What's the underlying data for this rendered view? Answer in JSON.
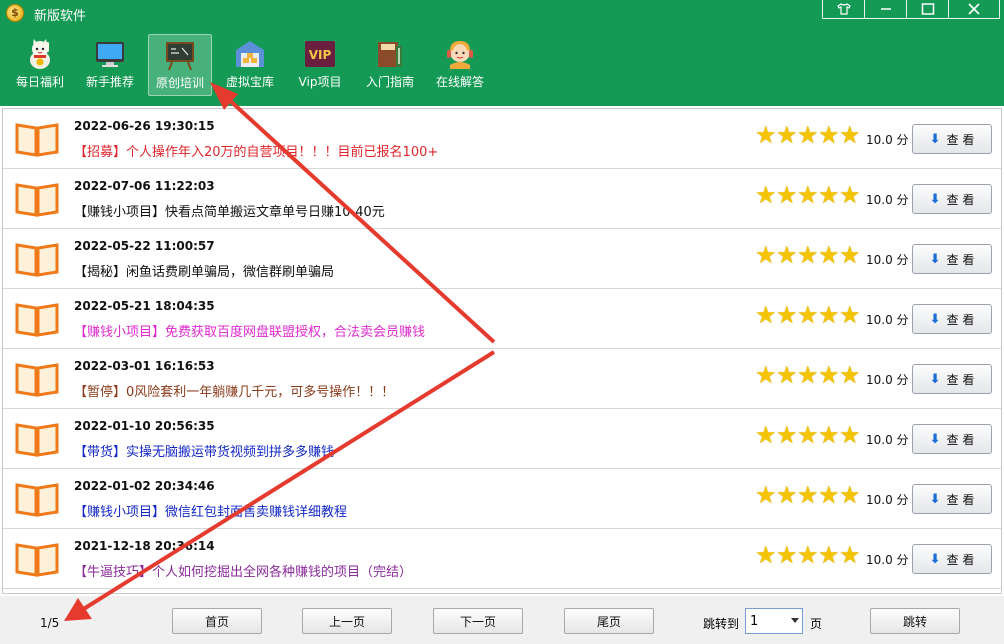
{
  "window": {
    "title": "新版软件",
    "logo_icon": "coin-icon",
    "controls": [
      "skin-icon",
      "minimize-icon",
      "maximize-icon",
      "close-icon"
    ]
  },
  "nav": {
    "items": [
      {
        "label": "每日福利",
        "icon": "lucky-cat-icon"
      },
      {
        "label": "新手推荐",
        "icon": "monitor-icon"
      },
      {
        "label": "原创培训",
        "icon": "blackboard-icon",
        "active": true
      },
      {
        "label": "虚拟宝库",
        "icon": "warehouse-icon"
      },
      {
        "label": "Vip项目",
        "icon": "vip-icon"
      },
      {
        "label": "入门指南",
        "icon": "books-icon"
      },
      {
        "label": "在线解答",
        "icon": "support-agent-icon"
      }
    ]
  },
  "list": {
    "view_label": "查 看",
    "items": [
      {
        "date": "2022-06-26 19:30:15",
        "title": "【招募】个人操作年入20万的自营项目！！！目前已报名100+",
        "color": "#e0262b",
        "rating": 5,
        "score": "10.0 分"
      },
      {
        "date": "2022-07-06 11:22:03",
        "title": "【赚钱小项目】快看点简单搬运文章单号日赚10-40元",
        "color": "#111111",
        "rating": 5,
        "score": "10.0 分"
      },
      {
        "date": "2022-05-22 11:00:57",
        "title": "【揭秘】闲鱼话费刷单骗局，微信群刷单骗局",
        "color": "#111111",
        "rating": 5,
        "score": "10.0 分"
      },
      {
        "date": "2022-05-21 18:04:35",
        "title": "【赚钱小项目】免费获取百度网盘联盟授权，合法卖会员赚钱",
        "color": "#e02ad0",
        "rating": 5,
        "score": "10.0 分"
      },
      {
        "date": "2022-03-01 16:16:53",
        "title": "【暂停】0风险套利一年躺赚几千元，可多号操作！！！",
        "color": "#8b3a1a",
        "rating": 5,
        "score": "10.0 分"
      },
      {
        "date": "2022-01-10 20:56:35",
        "title": "【带货】实操无脑搬运带货视频到拼多多赚钱",
        "color": "#1428c8",
        "rating": 5,
        "score": "10.0 分"
      },
      {
        "date": "2022-01-02 20:34:46",
        "title": "【赚钱小项目】微信红包封面售卖赚钱详细教程",
        "color": "#1428c8",
        "rating": 5,
        "score": "10.0 分"
      },
      {
        "date": "2021-12-18 20:36:14",
        "title": "【牛逼技巧】个人如何挖掘出全网各种赚钱的项目（完结）",
        "color": "#8a2a9a",
        "rating": 5,
        "score": "10.0 分"
      }
    ]
  },
  "footer": {
    "page_info": "1/5",
    "first": "首页",
    "prev": "上一页",
    "next": "下一页",
    "last": "尾页",
    "jump_to": "跳转到",
    "page_value": "1",
    "page_unit": "页",
    "jump": "跳转"
  },
  "colors": {
    "header_green": "#159a55",
    "annotation_red": "#e53a2e",
    "star_gold": "#f5c400"
  }
}
